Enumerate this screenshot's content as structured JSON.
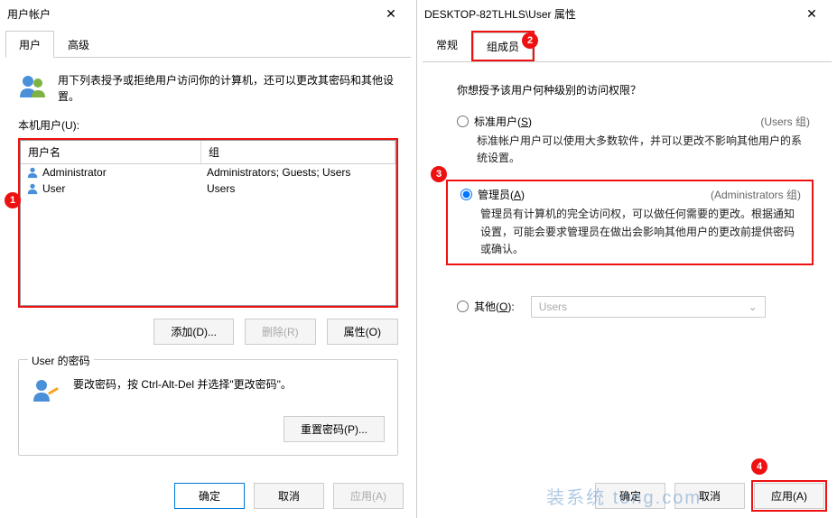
{
  "left": {
    "title": "用户帐户",
    "tabs": {
      "users": "用户",
      "advanced": "高级"
    },
    "intro": "用下列表授予或拒绝用户访问你的计算机，还可以更改其密码和其他设置。",
    "local_label": "本机用户(U):",
    "columns": {
      "name": "用户名",
      "group": "组"
    },
    "rows": [
      {
        "name": "Administrator",
        "group": "Administrators; Guests; Users"
      },
      {
        "name": "User",
        "group": "Users"
      }
    ],
    "buttons": {
      "add": "添加(D)...",
      "remove": "删除(R)",
      "props": "属性(O)"
    },
    "pwd_group_title": "User 的密码",
    "pwd_text": "要改密码，按 Ctrl-Alt-Del 并选择\"更改密码\"。",
    "reset_pwd": "重置密码(P)...",
    "footer": {
      "ok": "确定",
      "cancel": "取消",
      "apply": "应用(A)"
    }
  },
  "right": {
    "title": "DESKTOP-82TLHLS\\User 属性",
    "tabs": {
      "general": "常规",
      "members": "组成员"
    },
    "question": "你想授予该用户何种级别的访问权限？",
    "standard": {
      "label_pre": "标准用户(",
      "label_key": "S",
      "label_post": ")",
      "note": "(Users 组)",
      "desc": "标准帐户用户可以使用大多数软件，并可以更改不影响其他用户的系统设置。"
    },
    "admin": {
      "label_pre": "管理员(",
      "label_key": "A",
      "label_post": ")",
      "note": "(Administrators 组)",
      "desc": "管理员有计算机的完全访问权，可以做任何需要的更改。根据通知设置，可能会要求管理员在做出会影响其他用户的更改前提供密码或确认。"
    },
    "other": {
      "label_pre": "其他(",
      "label_key": "O",
      "label_post": "):",
      "select_value": "Users"
    },
    "footer": {
      "ok": "确定",
      "cancel": "取消",
      "apply": "应用(A)"
    }
  },
  "annotations": {
    "a1": "1",
    "a2": "2",
    "a3": "3",
    "a4": "4"
  },
  "watermark": "装系统  tong.com"
}
